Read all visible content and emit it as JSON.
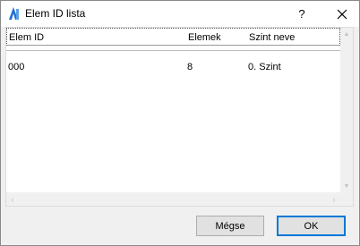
{
  "window": {
    "title": "Elem ID lista",
    "help_label": "?"
  },
  "list": {
    "columns": [
      "Elem ID",
      "Elemek",
      "Szint neve"
    ],
    "rows": [
      [
        "000",
        "8",
        "0. Szint"
      ]
    ]
  },
  "buttons": {
    "cancel": "Mégse",
    "ok": "OK"
  },
  "colors": {
    "accent": "#0078d7"
  }
}
